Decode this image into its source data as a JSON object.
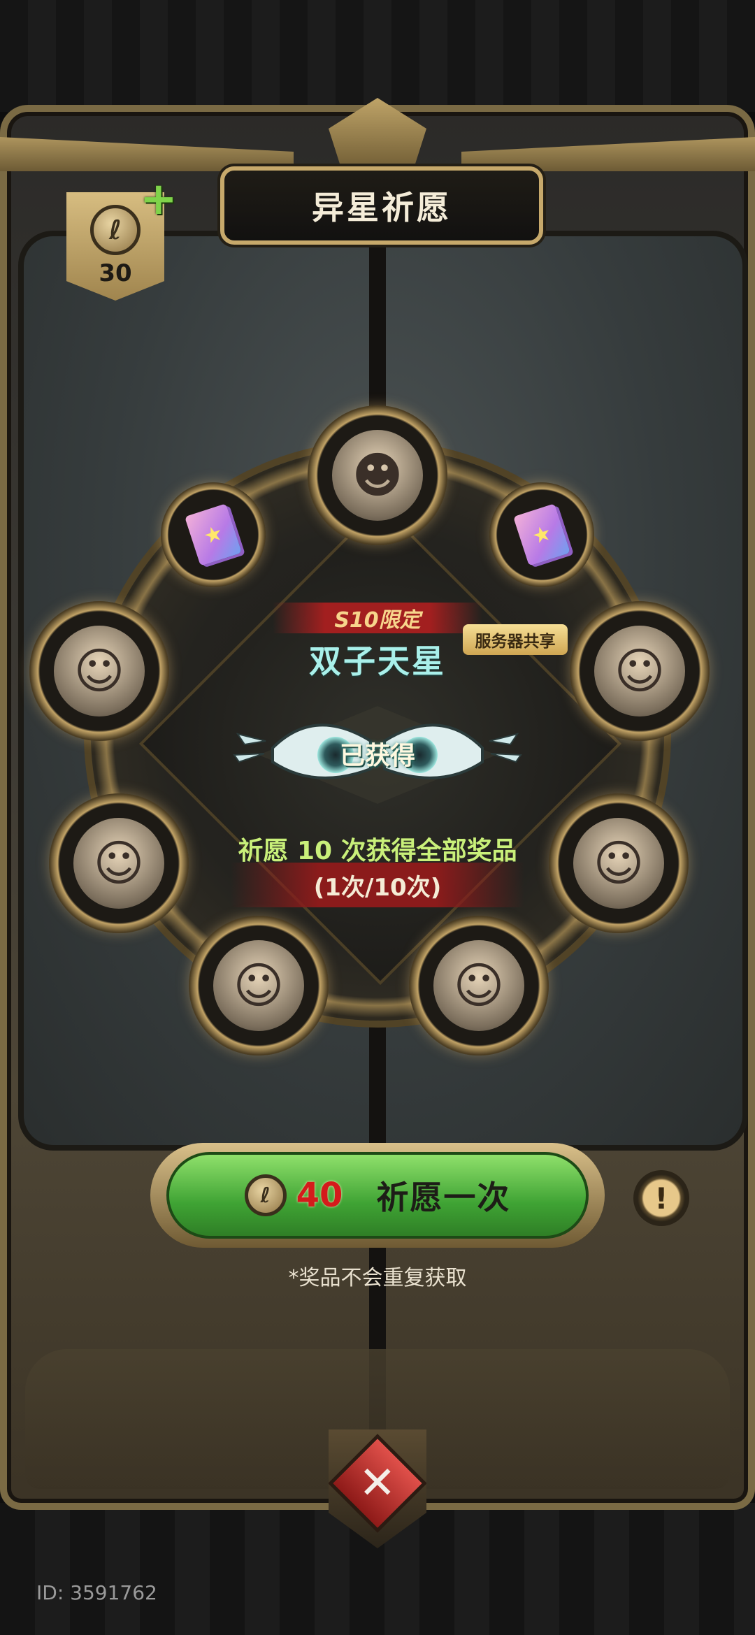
{
  "header": {
    "title": "异星祈愿"
  },
  "currency": {
    "count": "30",
    "coin_glyph": "ℓ"
  },
  "prize": {
    "limited_label": "S10限定",
    "name": "双子天星",
    "shared_tag": "服务器共享",
    "status": "已获得"
  },
  "wheel": {
    "slots": [
      {
        "name": "top",
        "glyph": "☻"
      },
      {
        "name": "upper-left-card",
        "glyph": "★"
      },
      {
        "name": "upper-right-card",
        "glyph": "★"
      },
      {
        "name": "left-1",
        "glyph": "☺"
      },
      {
        "name": "right-1",
        "glyph": "☺"
      },
      {
        "name": "left-2",
        "glyph": "☺"
      },
      {
        "name": "right-2",
        "glyph": "☺"
      },
      {
        "name": "bottom-left",
        "glyph": "☺"
      },
      {
        "name": "bottom-right",
        "glyph": "☺"
      }
    ]
  },
  "progress": {
    "hint": "祈愿 10 次获得全部奖品",
    "count_text": "(1次/10次)"
  },
  "pray_button": {
    "cost": "40",
    "label": "祈愿一次"
  },
  "info_glyph": "!",
  "note": "*奖品不会重复获取",
  "close_glyph": "✕",
  "user_id": "ID: 3591762"
}
